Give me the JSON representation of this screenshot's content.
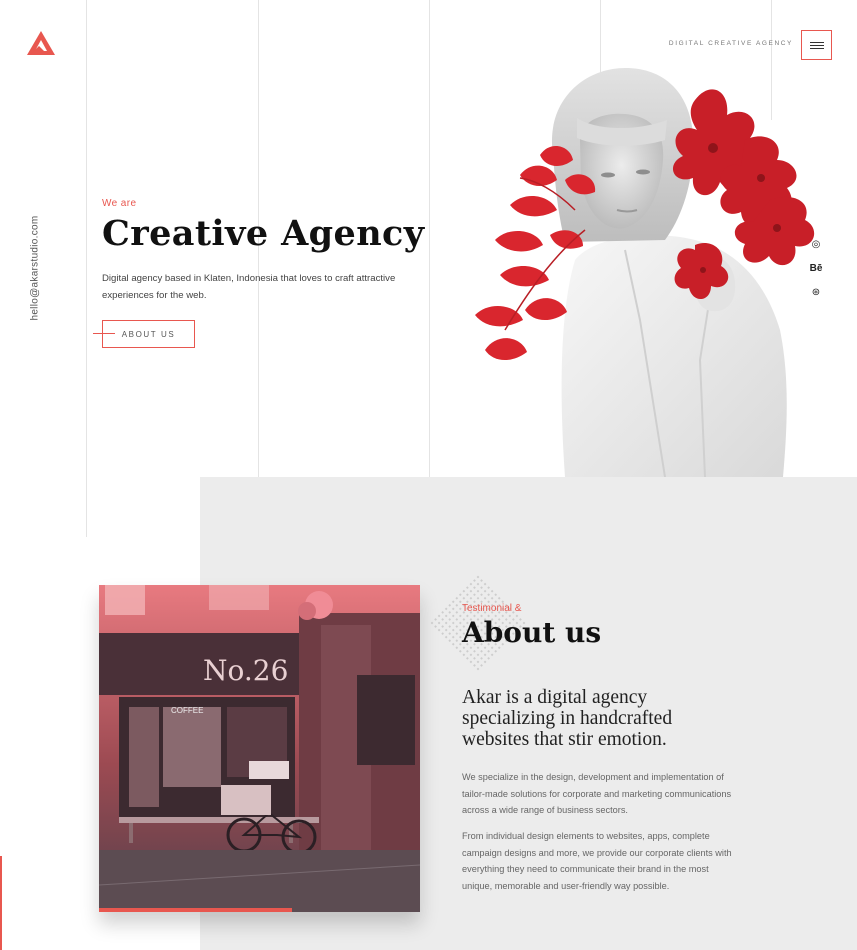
{
  "brand": {
    "logo_icon": "triangle-logo-icon",
    "accent_color": "#e8574f"
  },
  "header": {
    "tagline": "DIGITAL CREATIVE AGENCY",
    "menu_icon": "hamburger-icon"
  },
  "sidebar": {
    "email": "hello@akarstudio.com"
  },
  "hero": {
    "pre_title": "We are",
    "title": "Creative Agency",
    "description": "Digital agency based in Klaten, Indonesia that loves to craft attractive experiences for the web.",
    "button_label": "ABOUT US"
  },
  "socials": [
    {
      "icon": "instagram-icon",
      "glyph": "◎"
    },
    {
      "icon": "behance-icon",
      "glyph": "Bē"
    },
    {
      "icon": "dribbble-icon",
      "glyph": "⊛"
    }
  ],
  "about": {
    "pre_title": "Testimonial &",
    "title": "About us",
    "lead": "Akar is a digital agency specializing in handcrafted websites that stir emotion.",
    "paragraph_1": "We specialize in the design, development and implementation of tailor-made solutions for corporate and marketing communications across a wide range of business sectors.",
    "paragraph_2": "From individual design elements to websites, apps, complete campaign designs and more, we provide our corporate clients with everything they need to communicate their brand in the most unique, memorable and user-friendly way possible."
  },
  "storefront": {
    "shop_number": "No.26",
    "sign": "COFFEE"
  }
}
